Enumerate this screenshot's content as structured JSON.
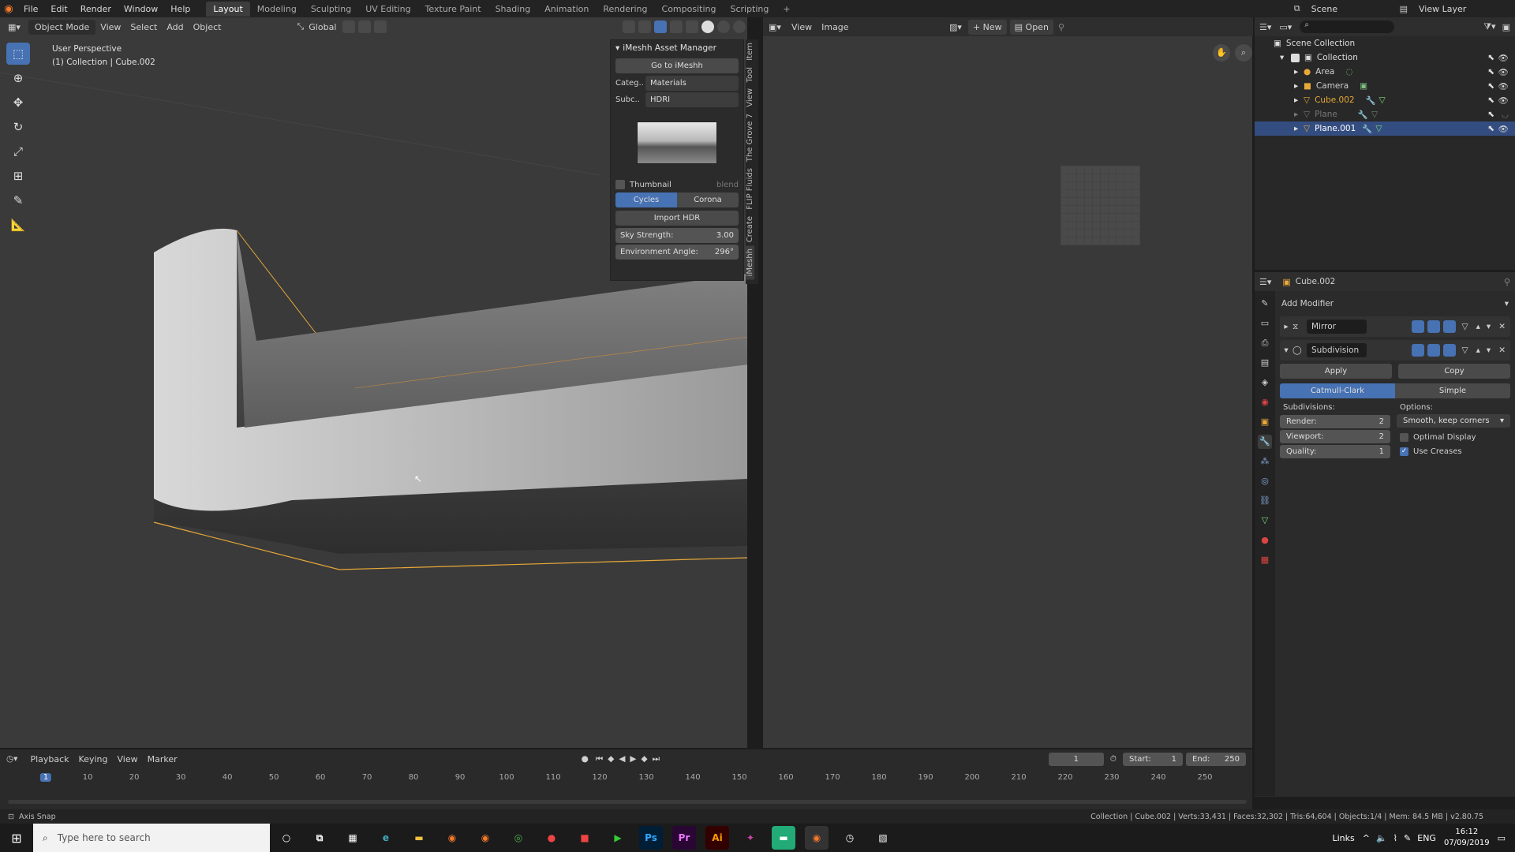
{
  "topbar": {
    "menus": [
      "File",
      "Edit",
      "Render",
      "Window",
      "Help"
    ],
    "workspaces": [
      "Layout",
      "Modeling",
      "Sculpting",
      "UV Editing",
      "Texture Paint",
      "Shading",
      "Animation",
      "Rendering",
      "Compositing",
      "Scripting"
    ],
    "scene_label": "Scene",
    "view_layer_label": "View Layer"
  },
  "viewport": {
    "mode": "Object Mode",
    "menus": [
      "View",
      "Select",
      "Add",
      "Object"
    ],
    "orientation": "Global",
    "overlay_title": "User Perspective",
    "overlay_sub": "(1) Collection | Cube.002"
  },
  "imeshh": {
    "title": "iMeshh Asset Manager",
    "goto_label": "Go to iMeshh",
    "category_label": "Categ..",
    "category_value": "Materials",
    "subcat_label": "Subc..",
    "subcat_value": "HDRI",
    "thumbnail_label": "Thumbnail",
    "blend_label": "blend",
    "cycles_label": "Cycles",
    "corona_label": "Corona",
    "import_label": "Import HDR",
    "sky_label": "Sky Strength:",
    "sky_value": "3.00",
    "env_label": "Environment Angle:",
    "env_value": "296°",
    "tabs": [
      "Item",
      "Tool",
      "View",
      "The Grove 7",
      "FLIP Fluids",
      "Create",
      "iMeshh"
    ]
  },
  "image_editor": {
    "menus": [
      "View",
      "Image"
    ],
    "new_label": "New",
    "open_label": "Open"
  },
  "outliner": {
    "root": "Scene Collection",
    "collection": "Collection",
    "items": [
      {
        "name": "Area",
        "color": "#d0d0d0"
      },
      {
        "name": "Camera",
        "color": "#d0d0d0"
      },
      {
        "name": "Cube.002",
        "color": "#e8a838"
      },
      {
        "name": "Plane",
        "color": "#777777"
      },
      {
        "name": "Plane.001",
        "color": "#ffffff"
      }
    ]
  },
  "properties": {
    "object_name": "Cube.002",
    "add_modifier": "Add Modifier",
    "mirror_name": "Mirror",
    "subsurf_name": "Subdivision",
    "apply_label": "Apply",
    "copy_label": "Copy",
    "catmull_label": "Catmull-Clark",
    "simple_label": "Simple",
    "subdivisions_label": "Subdivisions:",
    "options_label": "Options:",
    "render_label": "Render:",
    "render_value": "2",
    "viewport_label": "Viewport:",
    "viewport_value": "2",
    "quality_label": "Quality:",
    "quality_value": "1",
    "uv_option": "Smooth, keep corners",
    "optimal_label": "Optimal Display",
    "creases_label": "Use Creases"
  },
  "timeline": {
    "menus": [
      "Playback",
      "Keying",
      "View",
      "Marker"
    ],
    "current_frame": "1",
    "start_label": "Start:",
    "start_value": "1",
    "end_label": "End:",
    "end_value": "250",
    "ticks": [
      "1",
      "10",
      "20",
      "30",
      "40",
      "50",
      "60",
      "70",
      "80",
      "90",
      "100",
      "110",
      "120",
      "130",
      "140",
      "150",
      "160",
      "170",
      "180",
      "190",
      "200",
      "210",
      "220",
      "230",
      "240",
      "250"
    ]
  },
  "statusbar": {
    "left": "Axis Snap",
    "right": "Collection | Cube.002 | Verts:33,431 | Faces:32,302 | Tris:64,604 | Objects:1/4 | Mem: 84.5 MB | v2.80.75"
  },
  "taskbar": {
    "search_placeholder": "Type here to search",
    "apps": [
      {
        "label": "Ps",
        "color": "#31a8ff"
      },
      {
        "label": "Pr",
        "color": "#ea77ff"
      },
      {
        "label": "Ai",
        "color": "#ff9a00"
      }
    ],
    "links": "Links",
    "lang": "ENG",
    "time": "16:12",
    "date": "07/09/2019"
  },
  "colors": {
    "accent": "#4772b3",
    "selection_orange": "#e8a838"
  }
}
